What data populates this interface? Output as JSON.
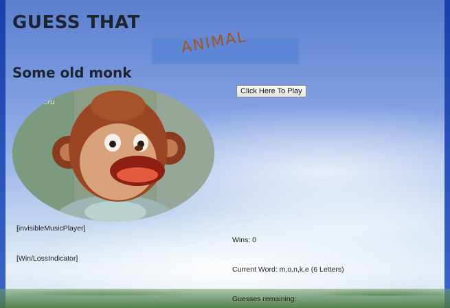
{
  "header": {
    "title": "GUESS THAT",
    "subtitle": "ANIMAL"
  },
  "hint": {
    "heading": "Some old monk",
    "image_alt": "monkey puppet",
    "watermark": "VPeru"
  },
  "controls": {
    "play_label": "Click Here To Play"
  },
  "placeholders": {
    "music_player": "[invisibleMusicPlayer]",
    "win_loss": "[Win/LossIndicator]"
  },
  "stats": {
    "wins": "Wins: 0",
    "current_word": "Current Word: m,o,n,k,e (6 Letters)",
    "guesses_remaining": "Guesses remaining:"
  },
  "colors": {
    "subtitle_bg": "#5e86d6",
    "subtitle_text": "#a5541c",
    "heading_text": "#1c2430"
  }
}
